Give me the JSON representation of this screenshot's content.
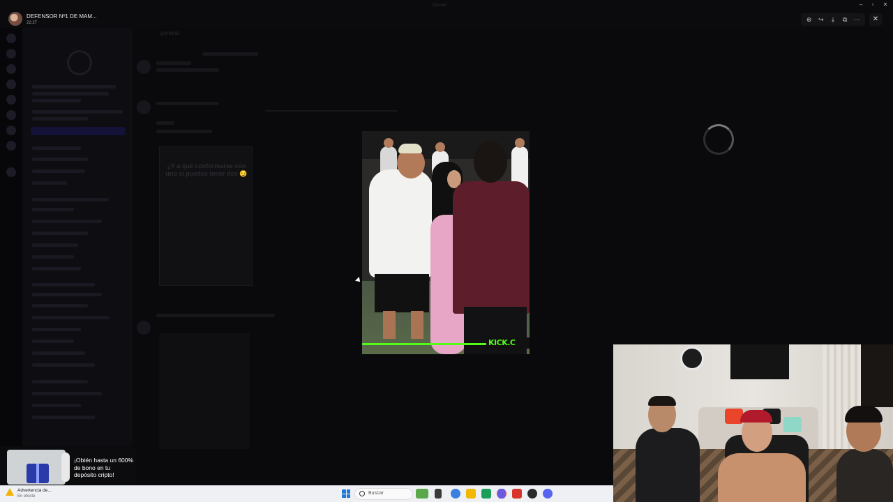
{
  "viewer": {
    "username": "DEFENSOR Nº1 DE MAM...",
    "time": "22:27",
    "window_title": "Discord"
  },
  "toolbar_icons": [
    "zoom-icon",
    "forward-icon",
    "download-icon",
    "open-external-icon",
    "more-icon"
  ],
  "background_discord": {
    "channel_name": "general",
    "embedded_caption": "¿Y a qué conformarse con uno si puedes tener dos 😏"
  },
  "media": {
    "watermark": "KICK.C"
  },
  "ad": {
    "text": "¡Obtén hasta un 600% de bono en tu depósito cripto!"
  },
  "taskbar": {
    "notification_title": "Advertencia de...",
    "notification_sub": "En efecto",
    "search_placeholder": "Buscar",
    "app_colors": [
      "#4aa84a",
      "#3a3a3a",
      "#3b7fe0",
      "#f2b800",
      "#1b9e5a",
      "#e84a2a",
      "#6a5ae0",
      "#d9342b",
      "#2a2a2a",
      "#5865f2"
    ]
  },
  "colors": {
    "kick_green": "#53fc18",
    "taskbar_bg": "#eef0f4",
    "start_blue": "#1e7ad7"
  }
}
